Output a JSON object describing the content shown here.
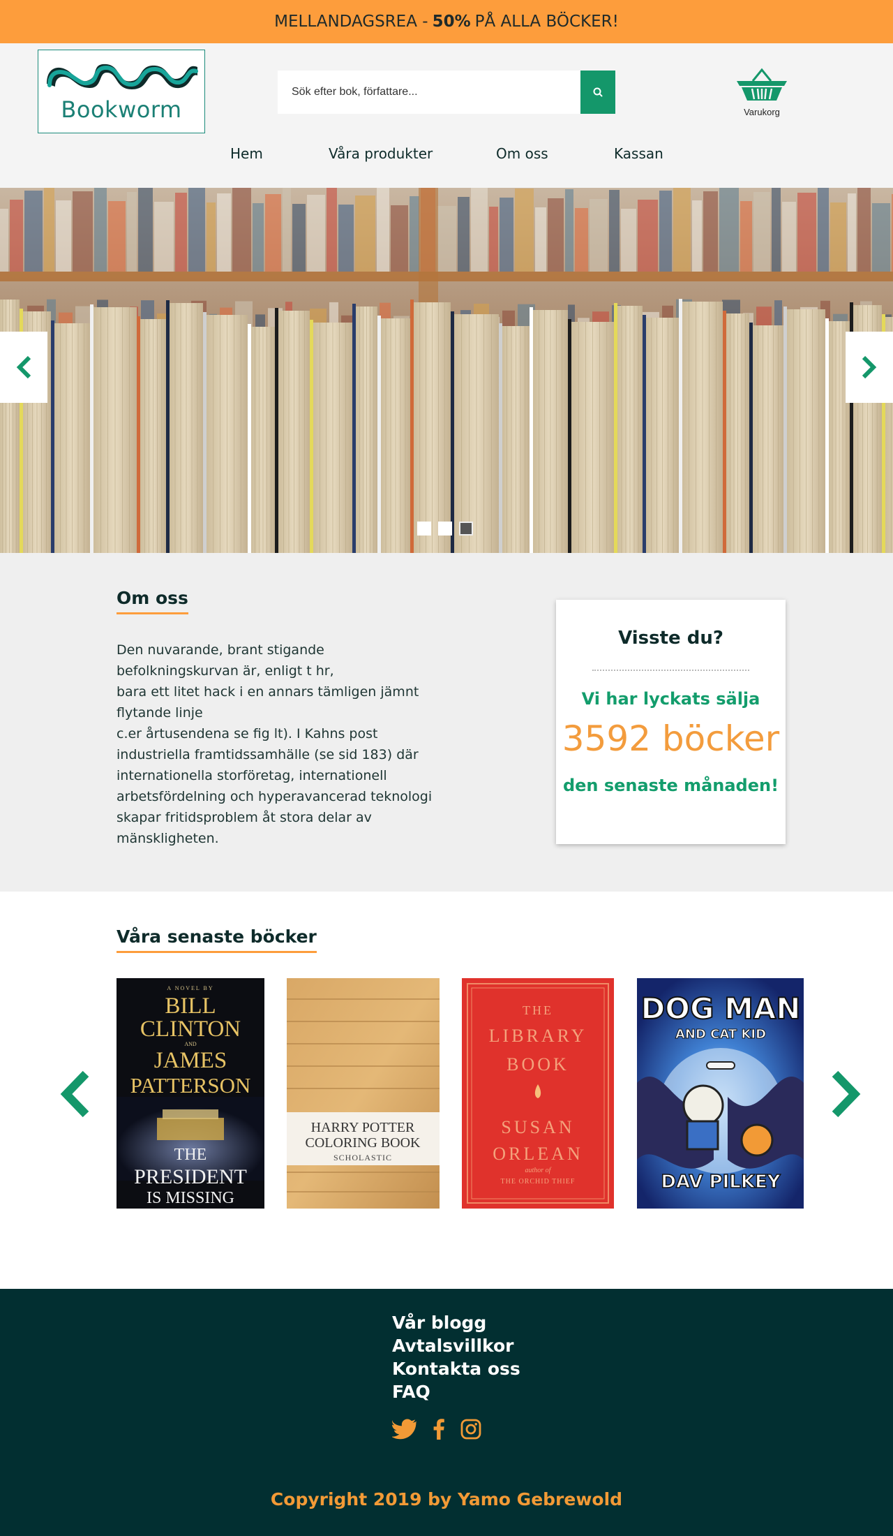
{
  "promo": {
    "prefix": "MELLANDAGSREA -",
    "highlight": "50%",
    "suffix": "PÅ ALLA BÖCKER!"
  },
  "header": {
    "logo_text": "Bookworm",
    "search": {
      "placeholder": "Sök efter bok, författare...",
      "button_icon": "search-icon"
    },
    "cart": {
      "label": "Varukorg",
      "icon": "basket-icon"
    }
  },
  "nav": {
    "items": [
      {
        "label": "Hem"
      },
      {
        "label": "Våra produkter"
      },
      {
        "label": "Om oss"
      },
      {
        "label": "Kassan"
      }
    ]
  },
  "hero": {
    "slide_count": 3,
    "active_slide": 3,
    "prev_icon": "chevron-left-icon",
    "next_icon": "chevron-right-icon"
  },
  "about": {
    "title": "Om oss",
    "lines": [
      "Den nuvarande, brant stigande",
      "befolkningskurvan är, enligt t hr,",
      "bara ett litet hack i en annars tämligen jämnt",
      "flytande linje",
      "c.er årtusendena se fig lt). I Kahns post",
      "industriella framtidssamhälle (se sid 183) där",
      "internationella storföretag, internationell",
      "arbetsfördelning och hyperavancerad teknologi",
      "skapar fritidsproblem åt stora delar av",
      "mänskligheten."
    ],
    "fact": {
      "title": "Visste du?",
      "line1": "Vi har lyckats sälja",
      "number": "3592 böcker",
      "line2": "den senaste månaden!"
    }
  },
  "books": {
    "title": "Våra senaste böcker",
    "items": [
      {
        "cover_lines": [
          "A NOVEL BY",
          "BILL",
          "CLINTON",
          "AND",
          "JAMES",
          "PATTERSON",
          "THE",
          "PRESIDENT",
          "IS MISSING"
        ]
      },
      {
        "cover_lines": [
          "HARRY POTTER",
          "COLORING BOOK",
          "SCHOLASTIC"
        ]
      },
      {
        "cover_lines": [
          "THE",
          "LIBRARY",
          "BOOK",
          "SUSAN",
          "ORLEAN",
          "author of",
          "THE ORCHID THIEF"
        ]
      },
      {
        "cover_lines": [
          "DOG MAN",
          "AND CAT KID",
          "DAV PILKEY"
        ]
      }
    ]
  },
  "footer": {
    "links": [
      {
        "label": "Vår blogg"
      },
      {
        "label": "Avtalsvillkor"
      },
      {
        "label": "Kontakta oss"
      },
      {
        "label": "FAQ"
      }
    ],
    "social": [
      "twitter-icon",
      "facebook-icon",
      "instagram-icon"
    ],
    "copyright": "Copyright 2019 by Yamo Gebrewold"
  },
  "colors": {
    "accent_orange": "#fd9d3c",
    "brand_green": "#14976a",
    "footer_bg": "#022f31",
    "teal": "#1b8075"
  }
}
